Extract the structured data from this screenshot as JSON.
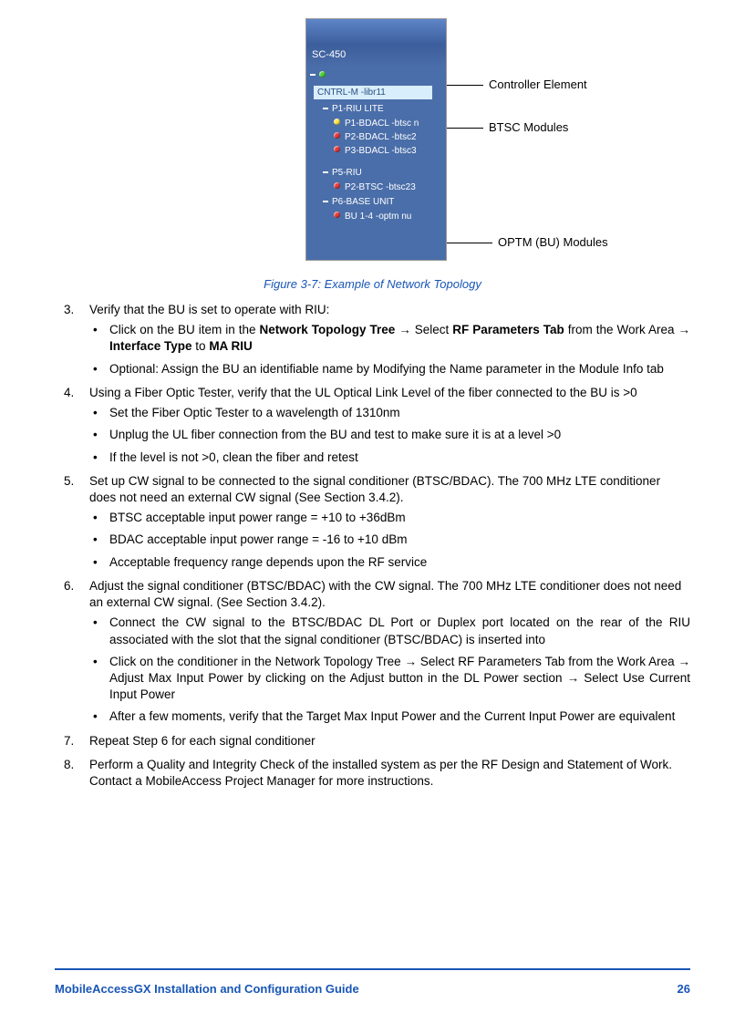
{
  "screenshot": {
    "band": "SC-450",
    "cntrl_box": "CNTRL-M -libr11",
    "p1": "P1-RIU LITE",
    "p1s1": "P1-BDACL -btsc n",
    "p1s2": "P2-BDACL -btsc2",
    "p1s3": "P3-BDACL -btsc3",
    "p5": "P5-RIU",
    "p5s1": "P2-BTSC -btsc23",
    "p6": "P6-BASE UNIT",
    "p6s1": "BU 1-4 -optm nu"
  },
  "callouts": {
    "controller": "Controller Element",
    "btsc": "BTSC Modules",
    "optm": "OPTM (BU) Modules"
  },
  "fig_caption": "Figure 3-7: Example of Network Topology",
  "steps": {
    "s3": "Verify that the BU is set to operate with RIU:",
    "s3b1_a": "Click on the BU item in the ",
    "s3b1_b": "Network Topology Tree",
    "s3b1_c": " → Select ",
    "s3b1_d": "RF Parameters Tab",
    "s3b1_e": " from the Work Area → ",
    "s3b1_f": "Interface Type",
    "s3b1_g": " to ",
    "s3b1_h": "MA RIU",
    "s3b2": "Optional: Assign the BU an identifiable name by Modifying the Name parameter in the Module Info tab",
    "s4": "Using a Fiber Optic Tester, verify that the UL Optical Link Level of the fiber connected to the BU is >0",
    "s4b1": "Set the Fiber Optic Tester to a wavelength of 1310nm",
    "s4b2": "Unplug the UL fiber connection from the BU and test to make sure it is at a level >0",
    "s4b3": "If the level is not >0, clean the fiber and retest",
    "s5": "Set up CW signal to be connected to the signal conditioner (BTSC/BDAC). The 700 MHz LTE conditioner does not need an external CW signal (See Section 3.4.2).",
    "s5b1": "BTSC acceptable input power range = +10 to +36dBm",
    "s5b2": "BDAC acceptable input power range = -16 to +10 dBm",
    "s5b3": "Acceptable frequency range depends upon the RF service",
    "s6": "Adjust the signal conditioner (BTSC/BDAC) with the CW signal. The 700 MHz LTE conditioner does not need an external CW signal. (See Section 3.4.2).",
    "s6b1": "Connect the CW signal to the BTSC/BDAC DL Port or Duplex port located on the rear of the RIU associated with the slot that the signal conditioner (BTSC/BDAC) is inserted into",
    "s6b2": "Click on the conditioner in the Network Topology Tree → Select RF Parameters Tab from the Work Area → Adjust Max Input Power by clicking on the Adjust button in the DL Power section → Select Use Current Input Power",
    "s6b3": "After a few moments, verify that the Target Max Input Power and the Current Input Power are equivalent",
    "s7": "Repeat Step 6 for each signal conditioner",
    "s8": "Perform a Quality and Integrity Check of the installed system as per the RF Design and Statement of Work.  Contact a MobileAccess Project Manager for more instructions."
  },
  "footer": {
    "title": "MobileAccessGX Installation and Configuration Guide",
    "page": "26"
  }
}
